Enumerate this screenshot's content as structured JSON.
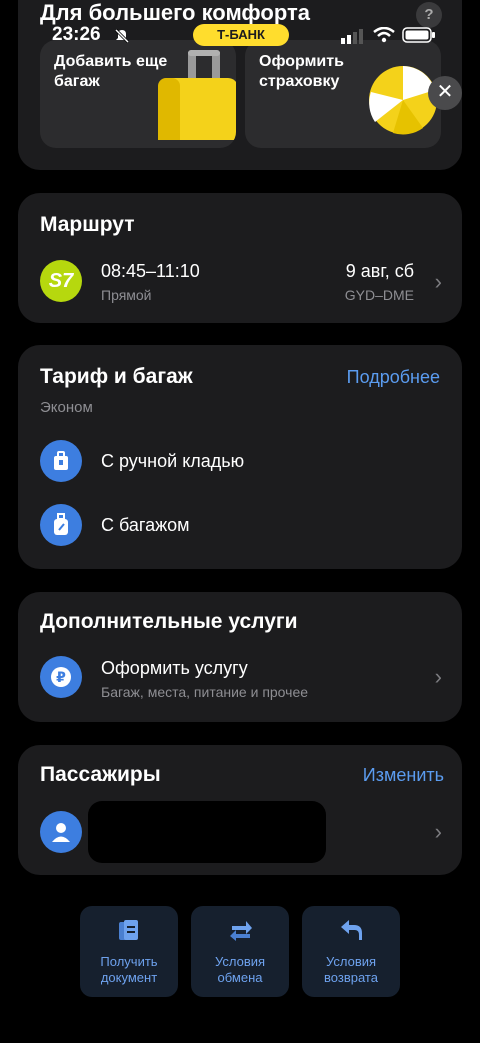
{
  "status_bar": {
    "time": "23:26",
    "carrier_badge": "Т-БАНК"
  },
  "comfort": {
    "title": "Для большего комфорта",
    "help": "?",
    "tiles": [
      {
        "label": "Добавить еще\nбагаж"
      },
      {
        "label": "Оформить\nстраховку"
      }
    ]
  },
  "route": {
    "title": "Маршрут",
    "airline": "S7",
    "time": "08:45–11:10",
    "type": "Прямой",
    "date": "9 авг, сб",
    "codes": "GYD–DME"
  },
  "tariff": {
    "title": "Тариф и багаж",
    "link": "Подробнее",
    "fare": "Эконом",
    "items": [
      {
        "label": "С ручной кладью"
      },
      {
        "label": "С багажом"
      }
    ]
  },
  "services": {
    "title": "Дополнительные услуги",
    "action": "Оформить услугу",
    "subtitle": "Багаж, места, питание и прочее"
  },
  "passengers": {
    "title": "Пассажиры",
    "link": "Изменить"
  },
  "bottom_actions": [
    {
      "label": "Получить\nдокумент"
    },
    {
      "label": "Условия\nобмена"
    },
    {
      "label": "Условия\nвозврата"
    }
  ],
  "colors": {
    "accent": "#5b9cf0",
    "card": "#1c1c1e",
    "brand_yellow": "#ffdd2d",
    "s7_green": "#b6d80e"
  }
}
